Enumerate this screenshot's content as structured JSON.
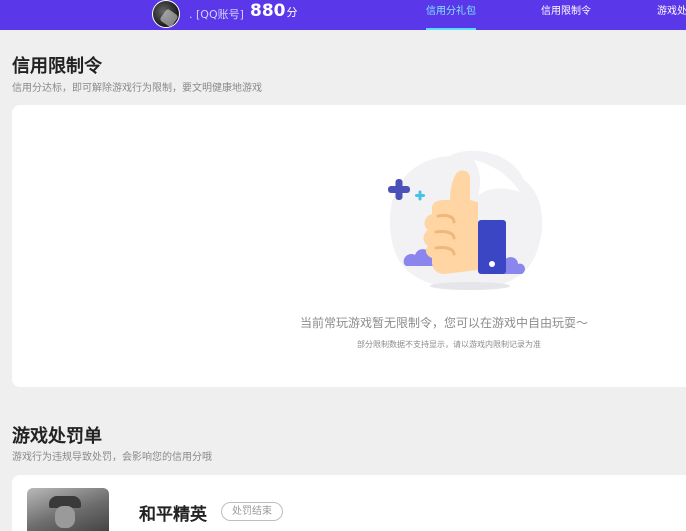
{
  "header": {
    "account_label": ". [QQ账号]",
    "score": "880",
    "score_unit": "分",
    "nav": [
      {
        "label": "信用分礼包",
        "active": true
      },
      {
        "label": "信用限制令",
        "active": false
      },
      {
        "label": "游戏处",
        "active": false
      }
    ]
  },
  "restriction": {
    "title": "信用限制令",
    "subtitle": "信用分达标，即可解除游戏行为限制，要文明健康地游戏",
    "empty_message": "当前常玩游戏暂无限制令，您可以在游戏中自由玩耍～",
    "empty_note": "部分限制数据不支持显示，请以游戏内限制记录为准",
    "illustration": "thumbs-up-icon"
  },
  "penalty": {
    "title": "游戏处罚单",
    "subtitle": "游戏行为违规导致处罚，会影响您的信用分哦",
    "items": [
      {
        "game": "和平精英",
        "status": "处罚结束"
      }
    ]
  },
  "colors": {
    "topbar": "#5a38ea",
    "nav_active": "#7fe6ff",
    "page_bg": "#efefef"
  }
}
